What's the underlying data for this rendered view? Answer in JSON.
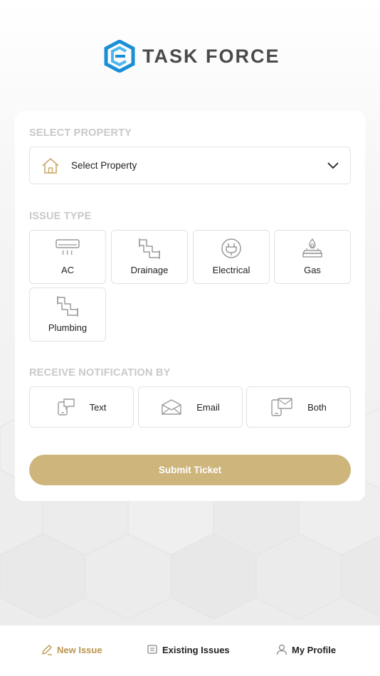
{
  "brand": {
    "name": "TASK FORCE"
  },
  "property": {
    "section_label": "SELECT PROPERTY",
    "placeholder": "Select Property",
    "icon": "home-icon"
  },
  "issue_type": {
    "section_label": "ISSUE TYPE",
    "items": [
      {
        "label": "AC",
        "icon": "air-conditioner-icon"
      },
      {
        "label": "Drainage",
        "icon": "pipe-icon"
      },
      {
        "label": "Electrical",
        "icon": "plug-icon"
      },
      {
        "label": "Gas",
        "icon": "gas-burner-icon"
      },
      {
        "label": "Plumbing",
        "icon": "pipe-icon"
      }
    ]
  },
  "notification": {
    "section_label": "RECEIVE NOTIFICATION BY",
    "options": [
      {
        "label": "Text",
        "icon": "phone-message-icon"
      },
      {
        "label": "Email",
        "icon": "envelope-icon"
      },
      {
        "label": "Both",
        "icon": "devices-icon"
      }
    ]
  },
  "submit": {
    "label": "Submit Ticket"
  },
  "tabbar": {
    "tabs": [
      {
        "label": "New Issue",
        "icon": "pencil-icon",
        "active": true
      },
      {
        "label": "Existing Issues",
        "icon": "list-icon",
        "active": false
      },
      {
        "label": "My Profile",
        "icon": "user-icon",
        "active": false
      }
    ]
  },
  "colors": {
    "accent": "#cdb57b",
    "active_tab": "#b9974f",
    "logo_blue": "#1a8fd6",
    "label_gray": "#c9c9c9"
  }
}
